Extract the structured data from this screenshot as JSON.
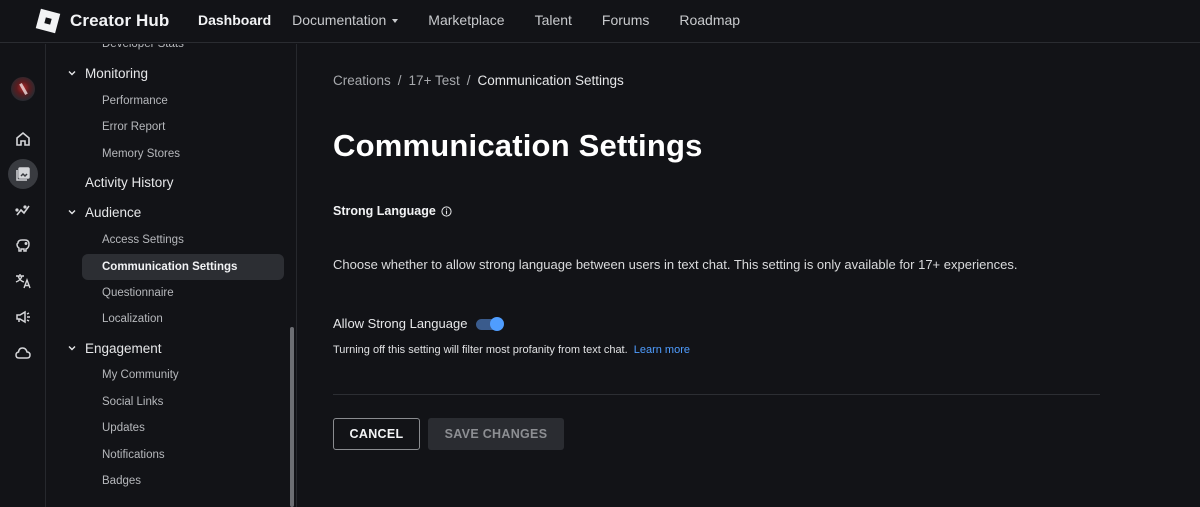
{
  "header": {
    "brand": "Creator Hub",
    "nav": [
      {
        "label": "Dashboard",
        "active": true
      },
      {
        "label": "Documentation",
        "has_dropdown": true
      },
      {
        "label": "Marketplace"
      },
      {
        "label": "Talent"
      },
      {
        "label": "Forums"
      },
      {
        "label": "Roadmap"
      }
    ]
  },
  "rail": {
    "items": [
      {
        "icon": "home-icon"
      },
      {
        "icon": "creations-icon",
        "active": true
      },
      {
        "icon": "analytics-icon"
      },
      {
        "icon": "monetization-icon"
      },
      {
        "icon": "translate-icon"
      },
      {
        "icon": "megaphone-icon"
      },
      {
        "icon": "cloud-icon"
      }
    ]
  },
  "sidebar": {
    "partial_top": "Developer Stats",
    "monitoring": {
      "label": "Monitoring",
      "items": [
        "Performance",
        "Error Report",
        "Memory Stores"
      ]
    },
    "activity_history": "Activity History",
    "audience": {
      "label": "Audience",
      "items": [
        "Access Settings",
        "Communication Settings",
        "Questionnaire",
        "Localization"
      ],
      "selected": "Communication Settings"
    },
    "engagement": {
      "label": "Engagement",
      "items": [
        "My Community",
        "Social Links",
        "Updates",
        "Notifications",
        "Badges"
      ]
    }
  },
  "breadcrumb": {
    "items": [
      "Creations",
      "17+ Test"
    ],
    "separator": "/",
    "current": "Communication Settings"
  },
  "main": {
    "title": "Communication Settings",
    "section_title": "Strong Language",
    "description": "Choose whether to allow strong language between users in text chat. This setting is only available for 17+ experiences.",
    "toggle": {
      "label": "Allow Strong Language",
      "enabled": true
    },
    "helper_text": "Turning off this setting will filter most profanity from text chat.",
    "learn_more": "Learn more",
    "buttons": {
      "cancel": "CANCEL",
      "save": "SAVE CHANGES"
    }
  },
  "colors": {
    "background": "#121317",
    "accent": "#4f9dff",
    "toggle_track": "#3a5b8c",
    "selected_item": "#2c2e33"
  }
}
